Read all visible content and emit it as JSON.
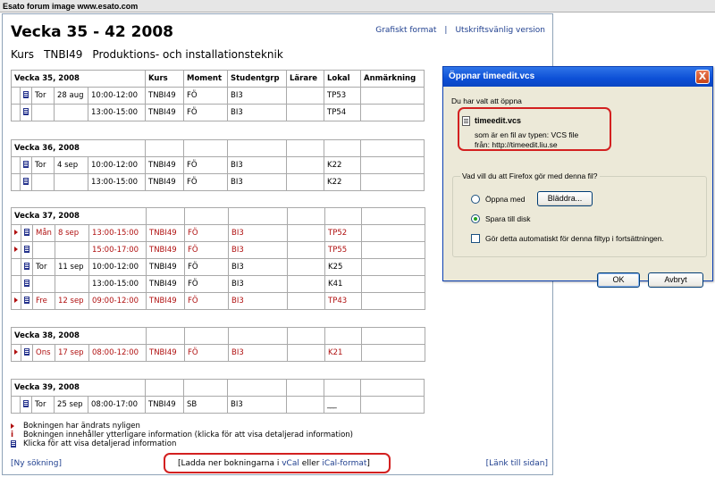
{
  "banner": "Esato forum image www.esato.com",
  "page": {
    "title": "Vecka 35 - 42 2008",
    "links": {
      "graphic": "Grafiskt format",
      "sep": "|",
      "print": "Utskriftsvänlig version"
    },
    "course": {
      "label": "Kurs",
      "code": "TNBI49",
      "name": "Produktions- och installationsteknik"
    },
    "headers": [
      "Kurs",
      "Moment",
      "Studentgrp",
      "Lärare",
      "Lokal",
      "Anmärkning"
    ],
    "weeks": [
      {
        "label": "Vecka 35, 2008",
        "rows": [
          {
            "changed": false,
            "day": "Tor",
            "date": "28 aug",
            "time": "10:00-12:00",
            "kurs": "TNBI49",
            "moment": "FÖ",
            "grp": "BI3",
            "teacher": "",
            "room": "TP53",
            "note": ""
          },
          {
            "changed": false,
            "day": "",
            "date": "",
            "time": "13:00-15:00",
            "kurs": "TNBI49",
            "moment": "FÖ",
            "grp": "BI3",
            "teacher": "",
            "room": "TP54",
            "note": ""
          }
        ]
      },
      {
        "label": "Vecka 36, 2008",
        "rows": [
          {
            "changed": false,
            "day": "Tor",
            "date": "4 sep",
            "time": "10:00-12:00",
            "kurs": "TNBI49",
            "moment": "FÖ",
            "grp": "BI3",
            "teacher": "",
            "room": "K22",
            "note": ""
          },
          {
            "changed": false,
            "day": "",
            "date": "",
            "time": "13:00-15:00",
            "kurs": "TNBI49",
            "moment": "FÖ",
            "grp": "BI3",
            "teacher": "",
            "room": "K22",
            "note": ""
          }
        ]
      },
      {
        "label": "Vecka 37, 2008",
        "rows": [
          {
            "changed": true,
            "day": "Mån",
            "date": "8 sep",
            "time": "13:00-15:00",
            "kurs": "TNBI49",
            "moment": "FÖ",
            "grp": "BI3",
            "teacher": "",
            "room": "TP52",
            "note": ""
          },
          {
            "changed": true,
            "day": "",
            "date": "",
            "time": "15:00-17:00",
            "kurs": "TNBI49",
            "moment": "FÖ",
            "grp": "BI3",
            "teacher": "",
            "room": "TP55",
            "note": ""
          },
          {
            "changed": false,
            "day": "Tor",
            "date": "11 sep",
            "time": "10:00-12:00",
            "kurs": "TNBI49",
            "moment": "FÖ",
            "grp": "BI3",
            "teacher": "",
            "room": "K25",
            "note": ""
          },
          {
            "changed": false,
            "day": "",
            "date": "",
            "time": "13:00-15:00",
            "kurs": "TNBI49",
            "moment": "FÖ",
            "grp": "BI3",
            "teacher": "",
            "room": "K41",
            "note": ""
          },
          {
            "changed": true,
            "day": "Fre",
            "date": "12 sep",
            "time": "09:00-12:00",
            "kurs": "TNBI49",
            "moment": "FÖ",
            "grp": "BI3",
            "teacher": "",
            "room": "TP43",
            "note": ""
          }
        ]
      },
      {
        "label": "Vecka 38, 2008",
        "rows": [
          {
            "changed": true,
            "day": "Ons",
            "date": "17 sep",
            "time": "08:00-12:00",
            "kurs": "TNBI49",
            "moment": "FÖ",
            "grp": "BI3",
            "teacher": "",
            "room": "K21",
            "note": ""
          }
        ]
      },
      {
        "label": "Vecka 39, 2008",
        "rows": [
          {
            "changed": false,
            "day": "Tor",
            "date": "25 sep",
            "time": "08:00-17:00",
            "kurs": "TNBI49",
            "moment": "SB",
            "grp": "BI3",
            "teacher": "",
            "room": "___",
            "note": ""
          }
        ]
      }
    ],
    "legend": {
      "changed": "Bokningen har ändrats nyligen",
      "info_symbol": "i",
      "info": "Bokningen innehåller ytterligare information (klicka för att visa detaljerad information)",
      "detail": "Klicka för att visa detaljerad information"
    },
    "bottom": {
      "new_search": "[Ny sökning]",
      "download_prefix": "[Ladda ner bokningarna i ",
      "vcal": "vCal",
      "or": " eller ",
      "ical": "iCal-format",
      "download_suffix": "]",
      "link_page": "[Länk till sidan]"
    }
  },
  "dialog": {
    "title": "Öppnar timeedit.vcs",
    "close": "X",
    "intro": "Du har valt att öppna",
    "file_name": "timeedit.vcs",
    "file_type": "som är en fil av typen:  VCS file",
    "file_from": "från:  http://timeedit.liu.se",
    "question": "Vad vill du att Firefox gör med denna fil?",
    "open_with": "Öppna med",
    "browse": "Bläddra...",
    "save": "Spara till disk",
    "auto": "Gör detta automatiskt för denna filtyp i fortsättningen.",
    "ok": "OK",
    "cancel": "Avbryt"
  },
  "colors": {
    "link": "#1f3f8f",
    "changed": "#b01010",
    "highlight": "#d32020",
    "titlebar": "#0c4fd6"
  }
}
